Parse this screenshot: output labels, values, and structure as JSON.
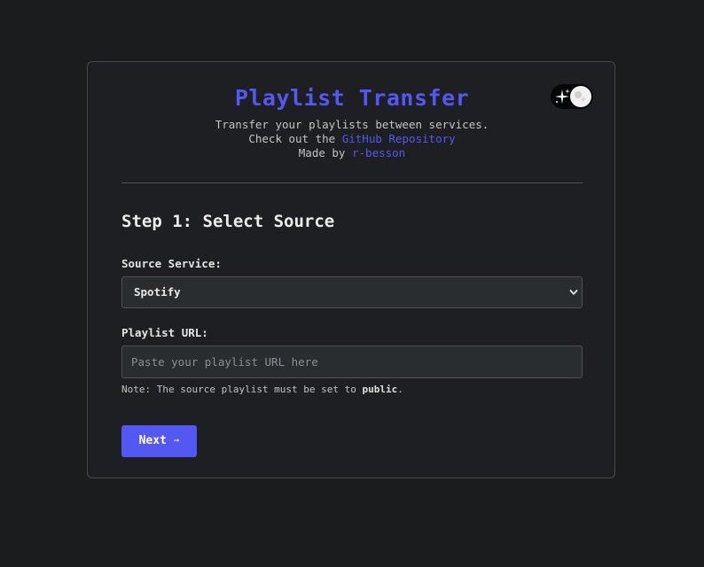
{
  "header": {
    "title": "Playlist Transfer",
    "tagline": "Transfer your playlists between services.",
    "repo_prefix": "Check out the",
    "repo_link": "GitHub Repository",
    "author_prefix": "Made by",
    "author_link": "r-besson"
  },
  "theme_toggle": {
    "icon": "stars-icon",
    "state": "dark"
  },
  "step": {
    "title": "Step 1: Select Source"
  },
  "source": {
    "label": "Source Service:",
    "selected": "Spotify"
  },
  "playlist": {
    "label": "Playlist URL:",
    "value": "",
    "placeholder": "Paste your playlist URL here"
  },
  "note": {
    "prefix": "Note: The source playlist must be set to",
    "emphasis": "public",
    "suffix": "."
  },
  "actions": {
    "next_label": "Next",
    "next_arrow": "➞"
  },
  "colors": {
    "accent": "#5458f2",
    "background": "#1b1c1e",
    "card": "#1e1f22",
    "field": "#2a2d30"
  }
}
